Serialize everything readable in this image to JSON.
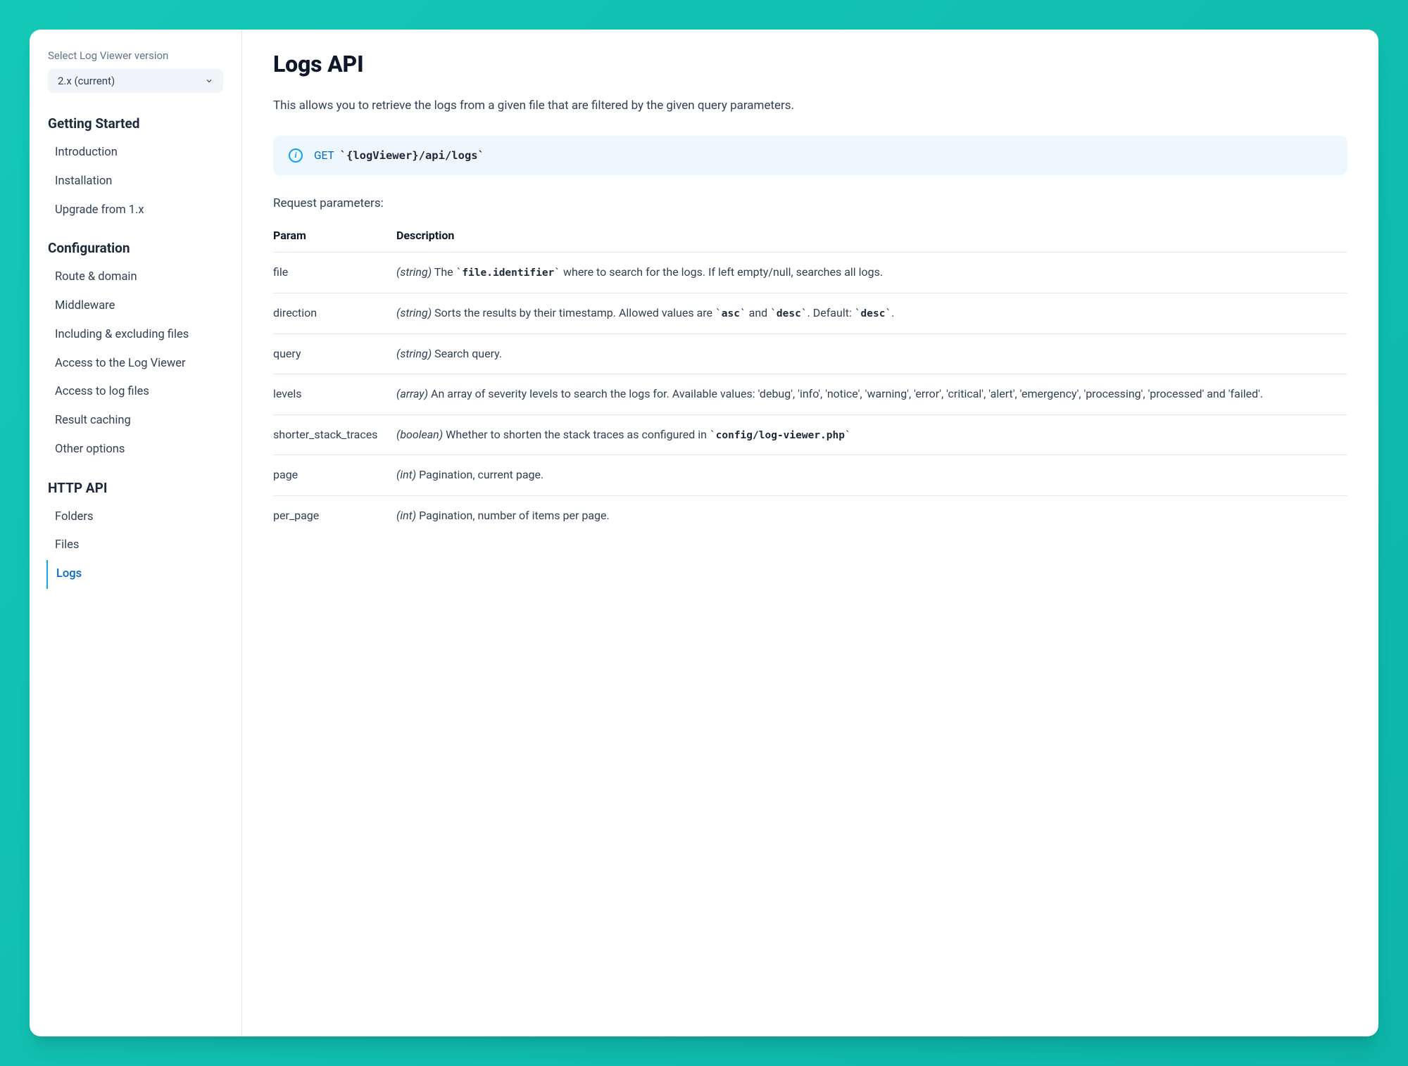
{
  "sidebar": {
    "version_label": "Select Log Viewer version",
    "version_selected": "2.x (current)",
    "sections": [
      {
        "title": "Getting Started",
        "items": [
          "Introduction",
          "Installation",
          "Upgrade from 1.x"
        ]
      },
      {
        "title": "Configuration",
        "items": [
          "Route & domain",
          "Middleware",
          "Including & excluding files",
          "Access to the Log Viewer",
          "Access to log files",
          "Result caching",
          "Other options"
        ]
      },
      {
        "title": "HTTP API",
        "items": [
          "Folders",
          "Files",
          "Logs"
        ]
      }
    ],
    "active_item": "Logs"
  },
  "page": {
    "title": "Logs API",
    "intro": "This allows you to retrieve the logs from a given file that are filtered by the given query parameters.",
    "endpoint": {
      "method": "GET",
      "path": "{logViewer}/api/logs"
    },
    "params_heading": "Request parameters:",
    "table_headers": {
      "param": "Param",
      "description": "Description"
    },
    "params": [
      {
        "name": "file",
        "type": "(string)",
        "desc_before": " The ",
        "code1": "file.identifier",
        "desc_mid1": " where to search for the logs. If left empty/null, searches all logs."
      },
      {
        "name": "direction",
        "type": "(string)",
        "desc_before": " Sorts the results by their timestamp. Allowed values are ",
        "code1": "asc",
        "desc_mid1": " and ",
        "code2": "desc",
        "desc_mid2": ". Default: ",
        "code3": "desc",
        "desc_after": "."
      },
      {
        "name": "query",
        "type": "(string)",
        "desc_before": " Search query."
      },
      {
        "name": "levels",
        "type": "(array)",
        "desc_before": " An array of severity levels to search the logs for. Available values: 'debug', 'info', 'notice', 'warning', 'error', 'critical', 'alert', 'emergency', 'processing', 'processed' and 'failed'."
      },
      {
        "name": "shorter_stack_traces",
        "type": "(boolean)",
        "desc_before": " Whether to shorten the stack traces as configured in ",
        "code1": "config/log-viewer.php"
      },
      {
        "name": "page",
        "type": "(int)",
        "desc_before": " Pagination, current page."
      },
      {
        "name": "per_page",
        "type": "(int)",
        "desc_before": " Pagination, number of items per page."
      }
    ]
  }
}
